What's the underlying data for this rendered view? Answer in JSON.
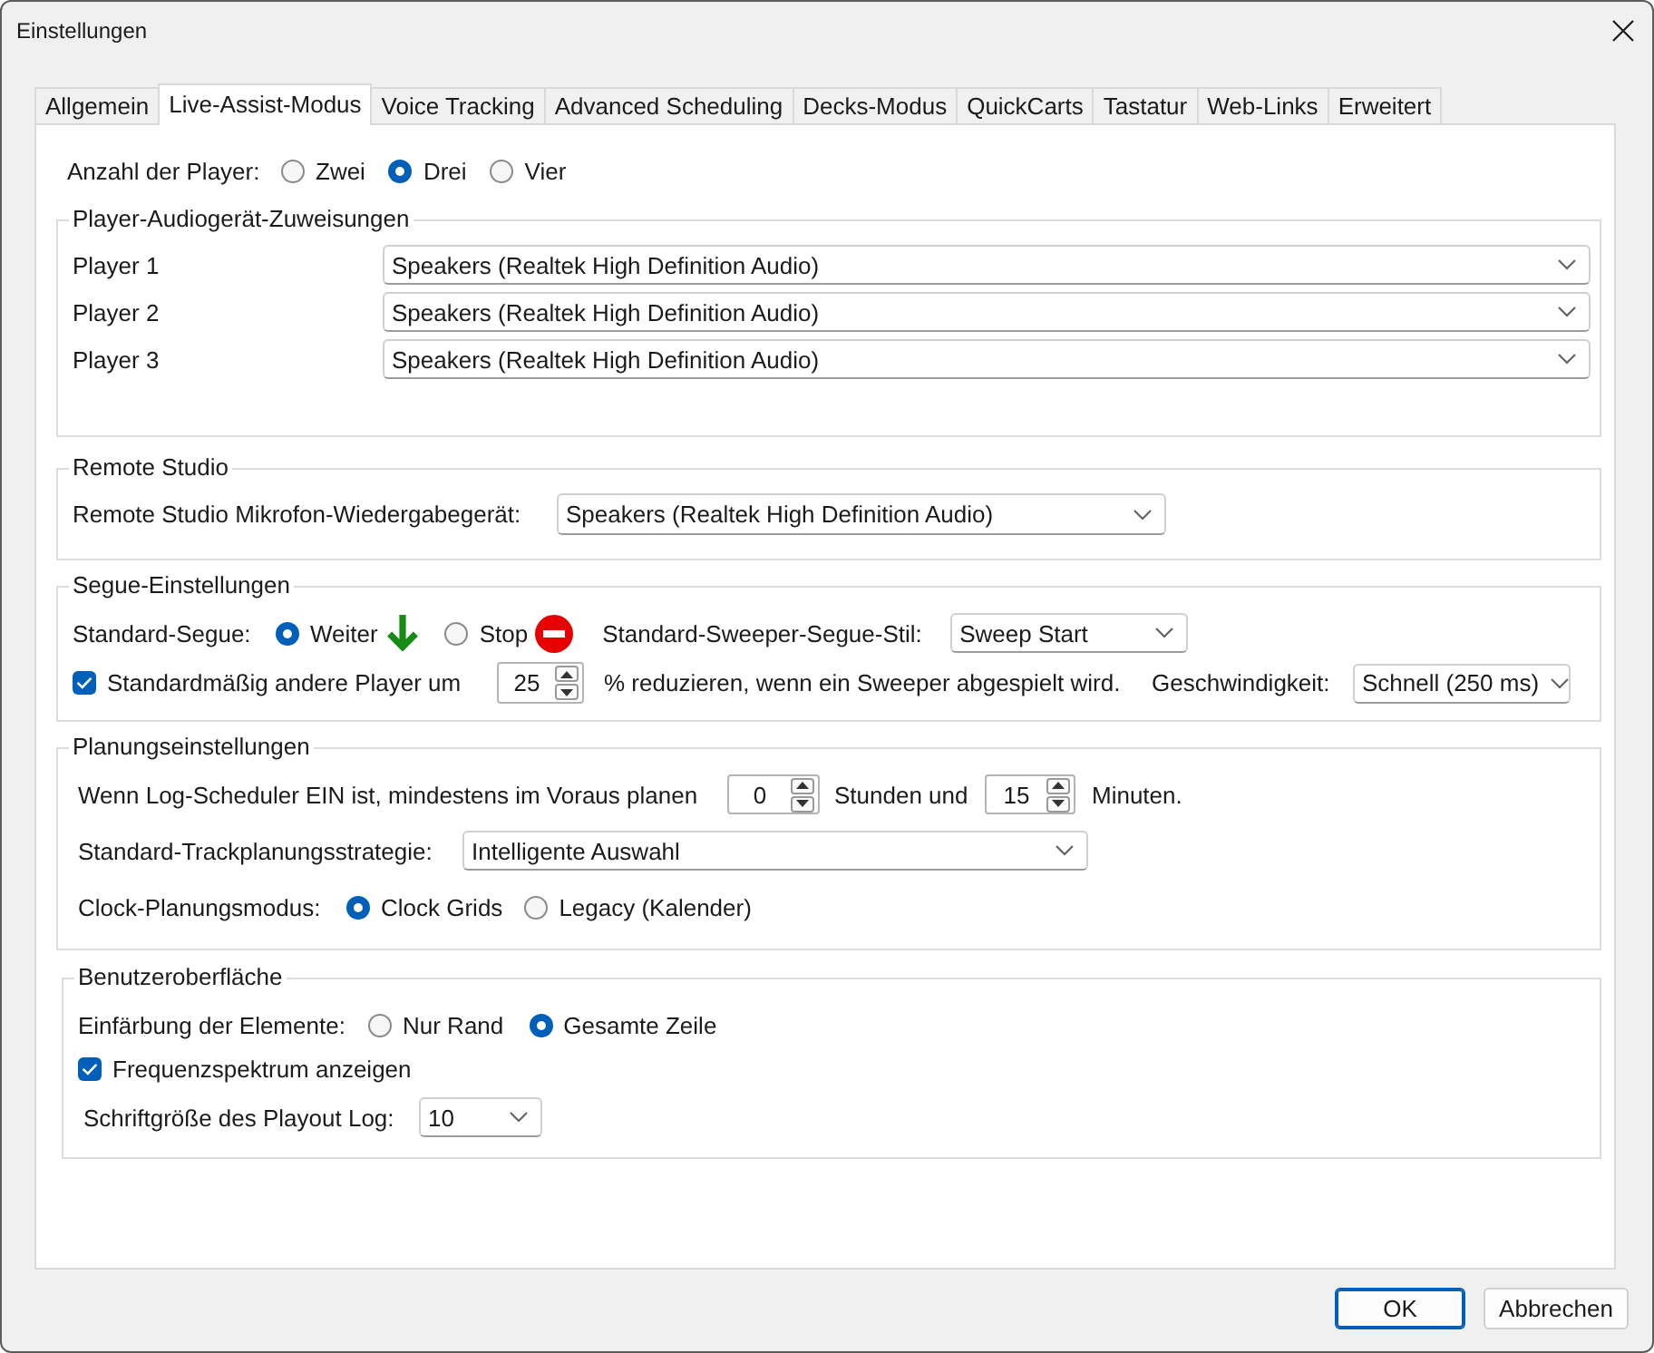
{
  "window": {
    "title": "Einstellungen"
  },
  "tabs": [
    {
      "label": "Allgemein",
      "selected": false
    },
    {
      "label": "Live-Assist-Modus",
      "selected": true
    },
    {
      "label": "Voice Tracking",
      "selected": false
    },
    {
      "label": "Advanced Scheduling",
      "selected": false
    },
    {
      "label": "Decks-Modus",
      "selected": false
    },
    {
      "label": "QuickCarts",
      "selected": false
    },
    {
      "label": "Tastatur",
      "selected": false
    },
    {
      "label": "Web-Links",
      "selected": false
    },
    {
      "label": "Erweitert",
      "selected": false
    }
  ],
  "player_count": {
    "label": "Anzahl der Player:",
    "options": [
      {
        "label": "Zwei",
        "selected": false
      },
      {
        "label": "Drei",
        "selected": true
      },
      {
        "label": "Vier",
        "selected": false
      }
    ]
  },
  "player_devices": {
    "title": "Player-Audiogerät-Zuweisungen",
    "rows": [
      {
        "label": "Player 1",
        "value": "Speakers (Realtek High Definition Audio)"
      },
      {
        "label": "Player 2",
        "value": "Speakers (Realtek High Definition Audio)"
      },
      {
        "label": "Player 3",
        "value": "Speakers (Realtek High Definition Audio)"
      }
    ]
  },
  "remote_studio": {
    "title": "Remote Studio",
    "label": "Remote Studio Mikrofon-Wiedergabegerät:",
    "value": "Speakers (Realtek High Definition Audio)"
  },
  "segue": {
    "title": "Segue-Einstellungen",
    "default_segue": {
      "label": "Standard-Segue:",
      "options": [
        {
          "label": "Weiter",
          "kind": "continue",
          "selected": true
        },
        {
          "label": "Stop",
          "kind": "stop",
          "selected": false
        }
      ]
    },
    "sweeper_style": {
      "label": "Standard-Sweeper-Segue-Stil:",
      "value": "Sweep Start"
    },
    "reduce": {
      "checked": true,
      "label": "Standardmäßig andere Player um",
      "value": "25",
      "suffix": "% reduzieren, wenn ein Sweeper abgespielt wird."
    },
    "speed": {
      "label": "Geschwindigkeit:",
      "value": "Schnell (250 ms)"
    }
  },
  "planning": {
    "title": "Planungseinstellungen",
    "advance": {
      "label": "Wenn Log-Scheduler EIN ist, mindestens im Voraus planen",
      "hours": "0",
      "hours_label": "Stunden und",
      "minutes": "15",
      "minutes_label": "Minuten."
    },
    "strategy": {
      "label": "Standard-Trackplanungsstrategie:",
      "value": "Intelligente Auswahl"
    },
    "clock_mode": {
      "label": "Clock-Planungsmodus:",
      "options": [
        {
          "label": "Clock Grids",
          "selected": true
        },
        {
          "label": "Legacy (Kalender)",
          "selected": false
        }
      ]
    }
  },
  "interface": {
    "title": "Benutzeroberfläche",
    "coloring": {
      "label": "Einfärbung der Elemente:",
      "options": [
        {
          "label": "Nur Rand",
          "selected": false
        },
        {
          "label": "Gesamte Zeile",
          "selected": true
        }
      ]
    },
    "spectrum": {
      "checked": true,
      "label": "Frequenzspektrum anzeigen"
    },
    "font_size": {
      "label": "Schriftgröße des Playout Log:",
      "value": "10"
    }
  },
  "buttons": [
    {
      "label": "OK",
      "default": true
    },
    {
      "label": "Abbrechen",
      "default": false
    }
  ]
}
